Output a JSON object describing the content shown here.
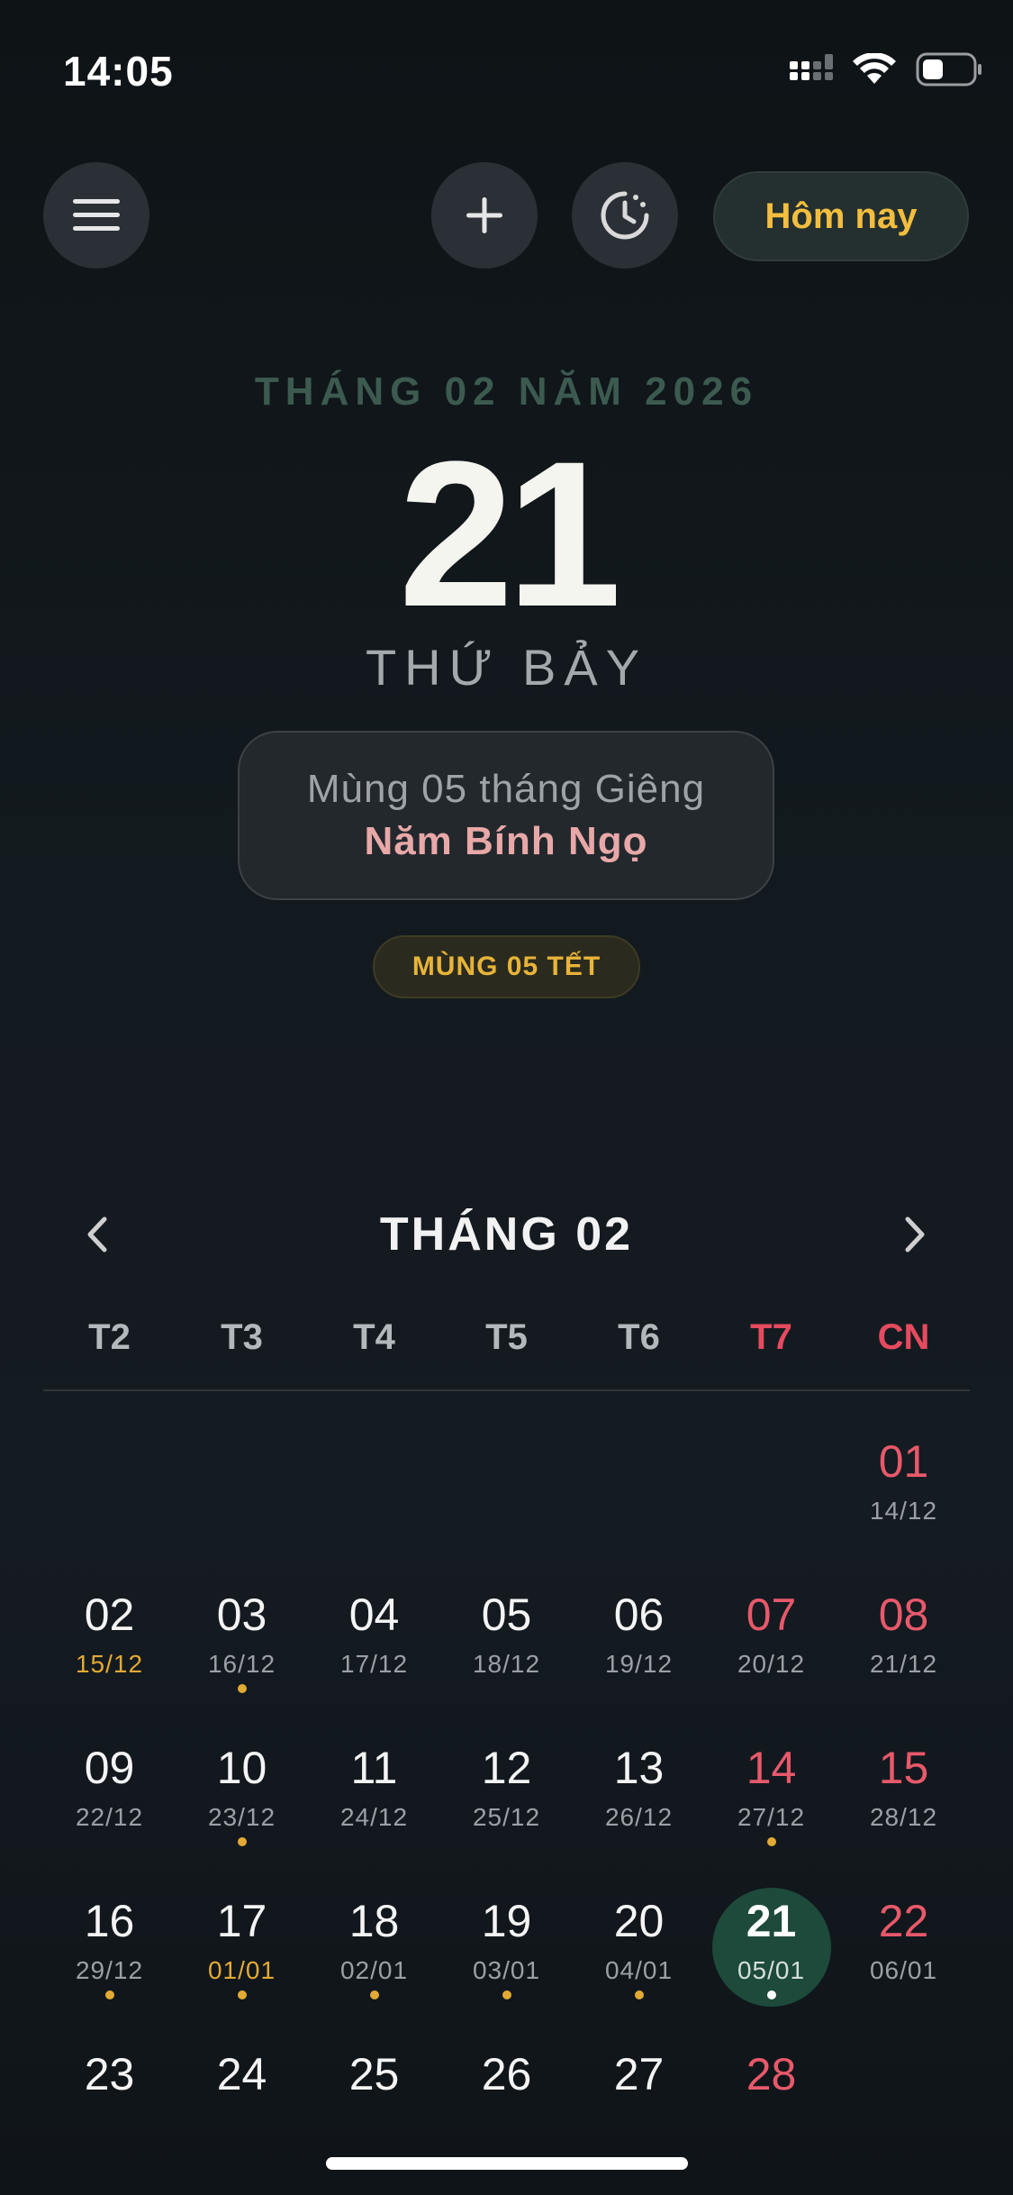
{
  "status_bar": {
    "time": "14:05"
  },
  "toolbar": {
    "today_label": "Hôm nay"
  },
  "header": {
    "month_year": "THÁNG 02 NĂM 2026",
    "day": "21",
    "weekday": "THỨ BẢY",
    "lunar_date": "Mùng 05 tháng Giêng",
    "lunar_year": "Năm Bính Ngọ",
    "event": "MÙNG 05 TẾT"
  },
  "calendar": {
    "title": "THÁNG 02",
    "weekdays": [
      "T2",
      "T3",
      "T4",
      "T5",
      "T6",
      "T7",
      "CN"
    ],
    "days": [
      {
        "d": "",
        "l": ""
      },
      {
        "d": "",
        "l": ""
      },
      {
        "d": "",
        "l": ""
      },
      {
        "d": "",
        "l": ""
      },
      {
        "d": "",
        "l": ""
      },
      {
        "d": "",
        "l": ""
      },
      {
        "d": "01",
        "l": "14/12",
        "weekend": true
      },
      {
        "d": "02",
        "l": "15/12",
        "gold": true
      },
      {
        "d": "03",
        "l": "16/12",
        "dot": true
      },
      {
        "d": "04",
        "l": "17/12"
      },
      {
        "d": "05",
        "l": "18/12"
      },
      {
        "d": "06",
        "l": "19/12"
      },
      {
        "d": "07",
        "l": "20/12",
        "weekend": true
      },
      {
        "d": "08",
        "l": "21/12",
        "weekend": true
      },
      {
        "d": "09",
        "l": "22/12"
      },
      {
        "d": "10",
        "l": "23/12",
        "dot": true
      },
      {
        "d": "11",
        "l": "24/12"
      },
      {
        "d": "12",
        "l": "25/12"
      },
      {
        "d": "13",
        "l": "26/12"
      },
      {
        "d": "14",
        "l": "27/12",
        "weekend": true,
        "dot": true
      },
      {
        "d": "15",
        "l": "28/12",
        "weekend": true
      },
      {
        "d": "16",
        "l": "29/12",
        "dot": true
      },
      {
        "d": "17",
        "l": "01/01",
        "gold": true,
        "dot": true
      },
      {
        "d": "18",
        "l": "02/01",
        "dot": true
      },
      {
        "d": "19",
        "l": "03/01",
        "dot": true
      },
      {
        "d": "20",
        "l": "04/01",
        "dot": true
      },
      {
        "d": "21",
        "l": "05/01",
        "weekend": true,
        "selected": true,
        "dot": true
      },
      {
        "d": "22",
        "l": "06/01",
        "weekend": true
      },
      {
        "d": "23",
        "l": ""
      },
      {
        "d": "24",
        "l": ""
      },
      {
        "d": "25",
        "l": ""
      },
      {
        "d": "26",
        "l": ""
      },
      {
        "d": "27",
        "l": ""
      },
      {
        "d": "28",
        "l": "",
        "weekend": true
      },
      {
        "d": "",
        "l": ""
      }
    ]
  },
  "colors": {
    "accent_gold": "#e2aa34",
    "weekend_red": "#e8596b",
    "selected_green": "#1d4a3a"
  }
}
